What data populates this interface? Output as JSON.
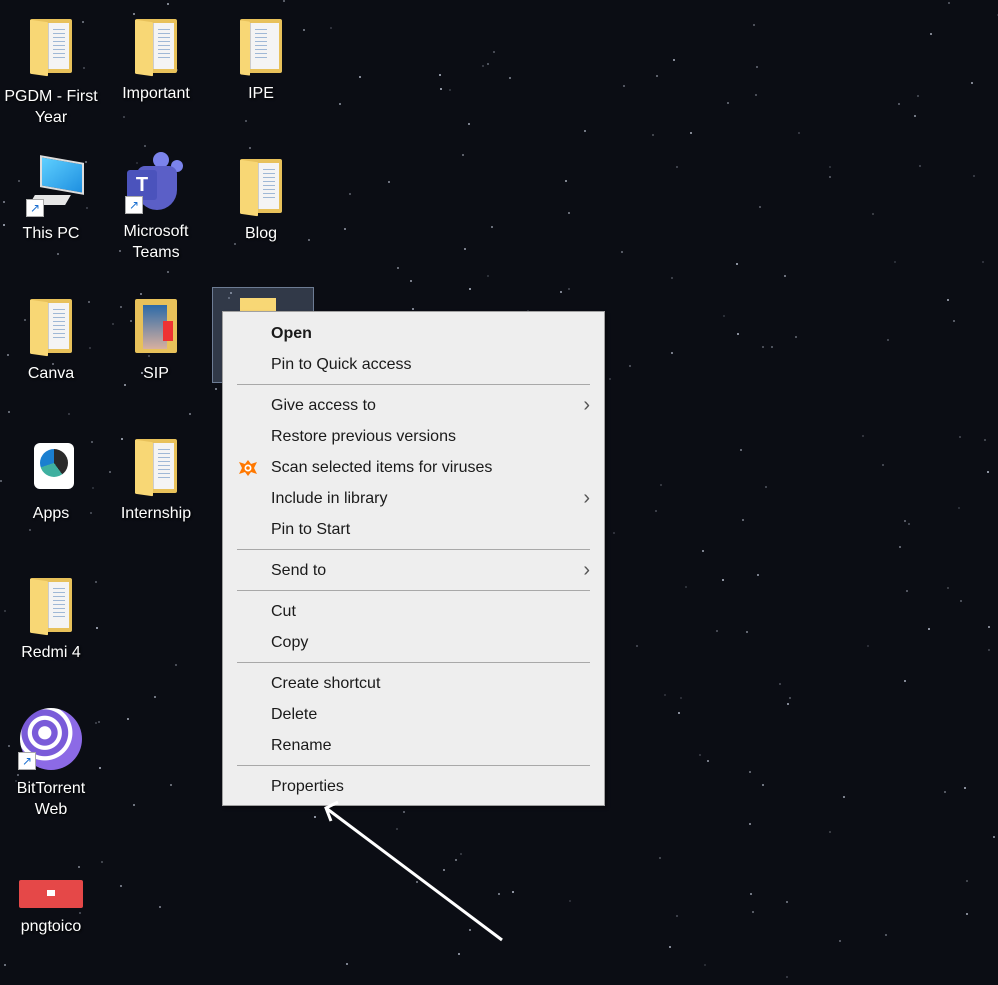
{
  "desktop": {
    "icons": [
      {
        "label": "PGDM - First Year",
        "type": "folder"
      },
      {
        "label": "Important",
        "type": "folder"
      },
      {
        "label": "IPE",
        "type": "folder"
      },
      {
        "label": "This PC",
        "type": "this-pc"
      },
      {
        "label": "Microsoft Teams",
        "type": "teams"
      },
      {
        "label": "Blog",
        "type": "folder"
      },
      {
        "label": "Canva",
        "type": "folder"
      },
      {
        "label": "SIP",
        "type": "folder"
      },
      {
        "label": "Apps",
        "type": "apps"
      },
      {
        "label": "Internship",
        "type": "folder"
      },
      {
        "label": "Redmi 4",
        "type": "folder"
      },
      {
        "label": "BitTorrent Web",
        "type": "bittorrent"
      },
      {
        "label": "pngtoico",
        "type": "pngtoico"
      }
    ]
  },
  "context_menu": {
    "open": "Open",
    "pin_quick_access": "Pin to Quick access",
    "give_access": "Give access to",
    "restore_versions": "Restore previous versions",
    "scan_viruses": "Scan selected items for viruses",
    "include_library": "Include in library",
    "pin_start": "Pin to Start",
    "send_to": "Send to",
    "cut": "Cut",
    "copy": "Copy",
    "create_shortcut": "Create shortcut",
    "delete": "Delete",
    "rename": "Rename",
    "properties": "Properties",
    "submenu_glyph": "›"
  },
  "colors": {
    "menu_bg": "#eeeeee",
    "avast_orange": "#ff7800",
    "annotation_arrow": "#ffffff"
  }
}
